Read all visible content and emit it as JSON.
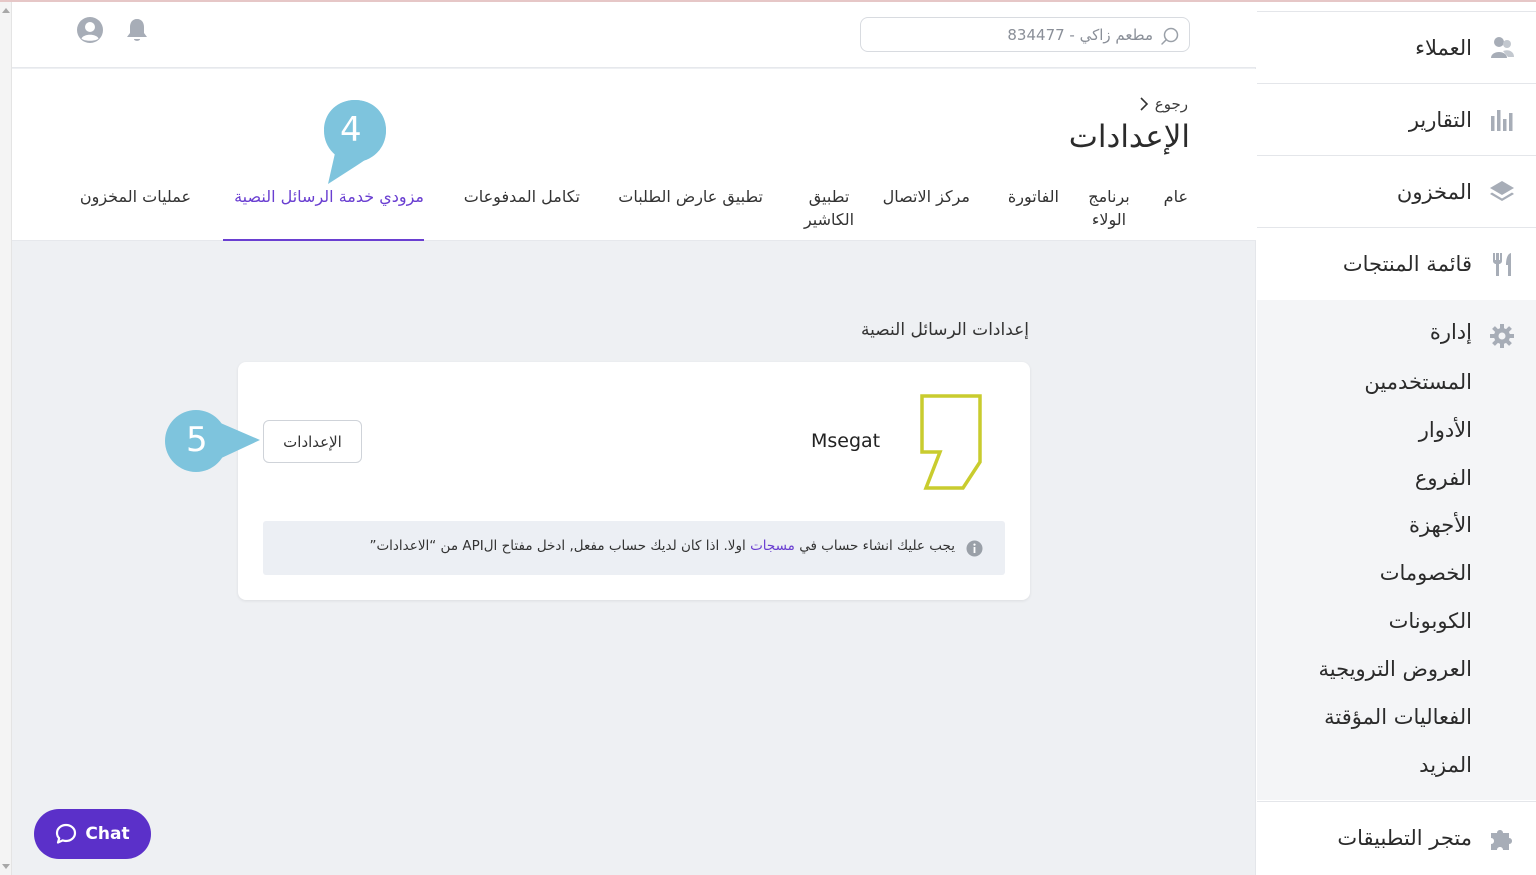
{
  "topbar": {
    "search_text": "مطعم زاكي - 834477",
    "icons": [
      "user-icon",
      "bell-icon",
      "search-icon"
    ]
  },
  "header": {
    "back_label": "رجوع",
    "title": "الإعدادات",
    "tabs": [
      {
        "label": "عام"
      },
      {
        "label": "برنامج الولاء"
      },
      {
        "label": "الفاتورة"
      },
      {
        "label": "مركز الاتصال"
      },
      {
        "label": "تطبيق الكاشير"
      },
      {
        "label": "تطبيق عارض الطلبات"
      },
      {
        "label": "تكامل المدفوعات"
      },
      {
        "label": "مزودي خدمة الرسائل النصية",
        "active": true
      },
      {
        "label": "عمليات المخزون"
      }
    ]
  },
  "content": {
    "section_title": "إعدادات الرسائل النصية",
    "provider": {
      "name": "Msegat",
      "button_label": "الإعدادات"
    },
    "info": {
      "text_before": "يجب عليك انشاء حساب في",
      "link": "مسجات",
      "text_after": "اولا. اذا كان لديك حساب مفعل, ادخل مفتاح الAPI من “الاعدادات”"
    }
  },
  "callouts": [
    {
      "number": "4"
    },
    {
      "number": "5"
    }
  ],
  "chat": {
    "label": "Chat"
  },
  "sidebar": {
    "items": [
      {
        "label": "العملاء",
        "icon": "customers-icon"
      },
      {
        "label": "التقارير",
        "icon": "reports-icon"
      },
      {
        "label": "المخزون",
        "icon": "inventory-icon"
      },
      {
        "label": "قائمة المنتجات",
        "icon": "menu-icon"
      }
    ],
    "admin": {
      "label": "إدارة",
      "icon": "gear-icon",
      "sub_items": [
        "المستخدمين",
        "الأدوار",
        "الفروع",
        "الأجهزة",
        "الخصومات",
        "الكوبونات",
        "العروض الترويجية",
        "الفعاليات المؤقتة",
        "المزيد"
      ]
    },
    "marketplace": {
      "label": "متجر التطبيقات",
      "icon": "puzzle-icon"
    }
  },
  "colors": {
    "accent": "#6a3fd1",
    "chat_bg": "#5b30c9",
    "callout": "#7ec4dd",
    "logo": "#c9cc2e"
  }
}
